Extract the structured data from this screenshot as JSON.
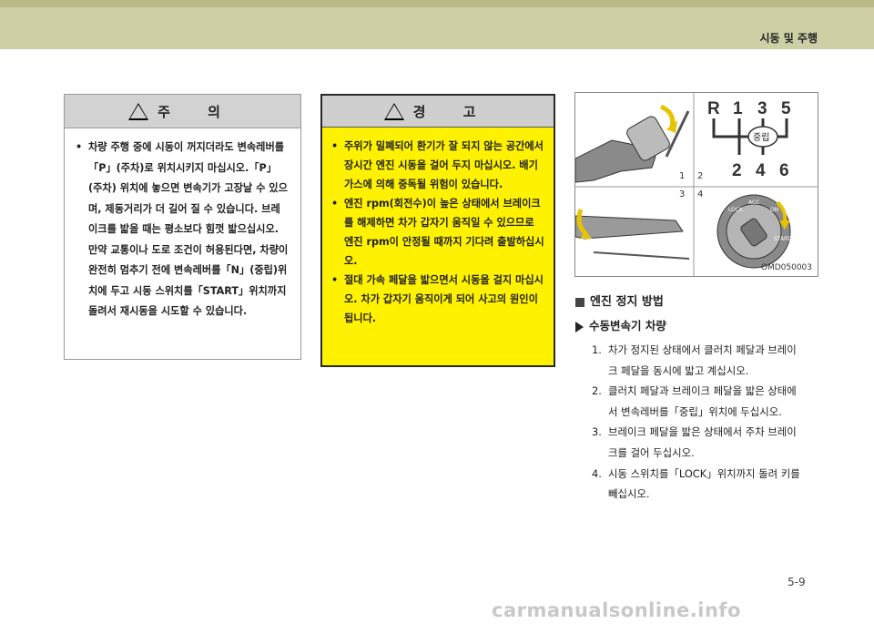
{
  "header": {
    "section_title": "시동 및 주행"
  },
  "caution": {
    "title": "주  의",
    "items": [
      "차량 주행 중에 시동이 꺼지더라도 변속레버를「P」(주차)로 위치시키지 마십시오.「P」(주차) 위치에 놓으면 변속기가 고장날 수 있으며, 제동거리가 더 길어 질 수 있습니다. 브레이크를 밟을 때는 평소보다 힘껏 밟으십시오. 만약 교통이나 도로 조건이 허용된다면, 차량이 완전히 멈추기 전에 변속레버를「N」(중립)위치에 두고 시동 스위치를「START」위치까지 돌려서 재시동을 시도할 수 있습니다."
    ]
  },
  "warning": {
    "title": "경  고",
    "items": [
      "주위가 밀폐되어 환기가 잘 되지 않는 공간에서 장시간 엔진 시동을 걸어 두지 마십시오. 배기가스에 의해 중독될 위험이 있습니다.",
      "엔진 rpm(회전수)이 높은 상태에서 브레이크를 해제하면 차가 갑자기 움직일 수 있으므로 엔진 rpm이 안정될 때까지 기다려 출발하십시오.",
      "절대 가속 페달을 밟으면서 시동을 걸지 마십시오. 차가 갑자기 움직이게 되어 사고의 원인이 됩니다."
    ]
  },
  "figure": {
    "code": "OMD050003",
    "panel_numbers": [
      "1",
      "2",
      "3",
      "4"
    ],
    "gear_labels_top": [
      "R",
      "1",
      "3",
      "5"
    ],
    "gear_labels_bottom": [
      "2",
      "4",
      "6"
    ],
    "neutral_label": "중립",
    "key_labels": [
      "LOCK",
      "ACC",
      "ON",
      "START"
    ]
  },
  "section": {
    "title": "엔진 정지 방법",
    "subtitle": "수동변속기 차량",
    "steps": [
      {
        "num": "1.",
        "text": "차가 정지된 상태에서 클러치 페달과 브레이크 페달을 동시에 밟고 계십시오."
      },
      {
        "num": "2.",
        "text": "클러치 페달과 브레이크 페달을 밟은 상태에서 변속레버를「중립」위치에 두십시오."
      },
      {
        "num": "3.",
        "text": "브레이크 페달을 밟은 상태에서 주차 브레이크를 걸어 두십시오."
      },
      {
        "num": "4.",
        "text": "시동 스위치를「LOCK」위치까지 돌려 키를 빼십시오."
      }
    ]
  },
  "page_number": "5-9",
  "watermark": "carmanualsonline.info",
  "colors": {
    "top_band": "#cfcfa6",
    "warning_bg": "#fff200",
    "box_header": "#d2d2d2"
  }
}
